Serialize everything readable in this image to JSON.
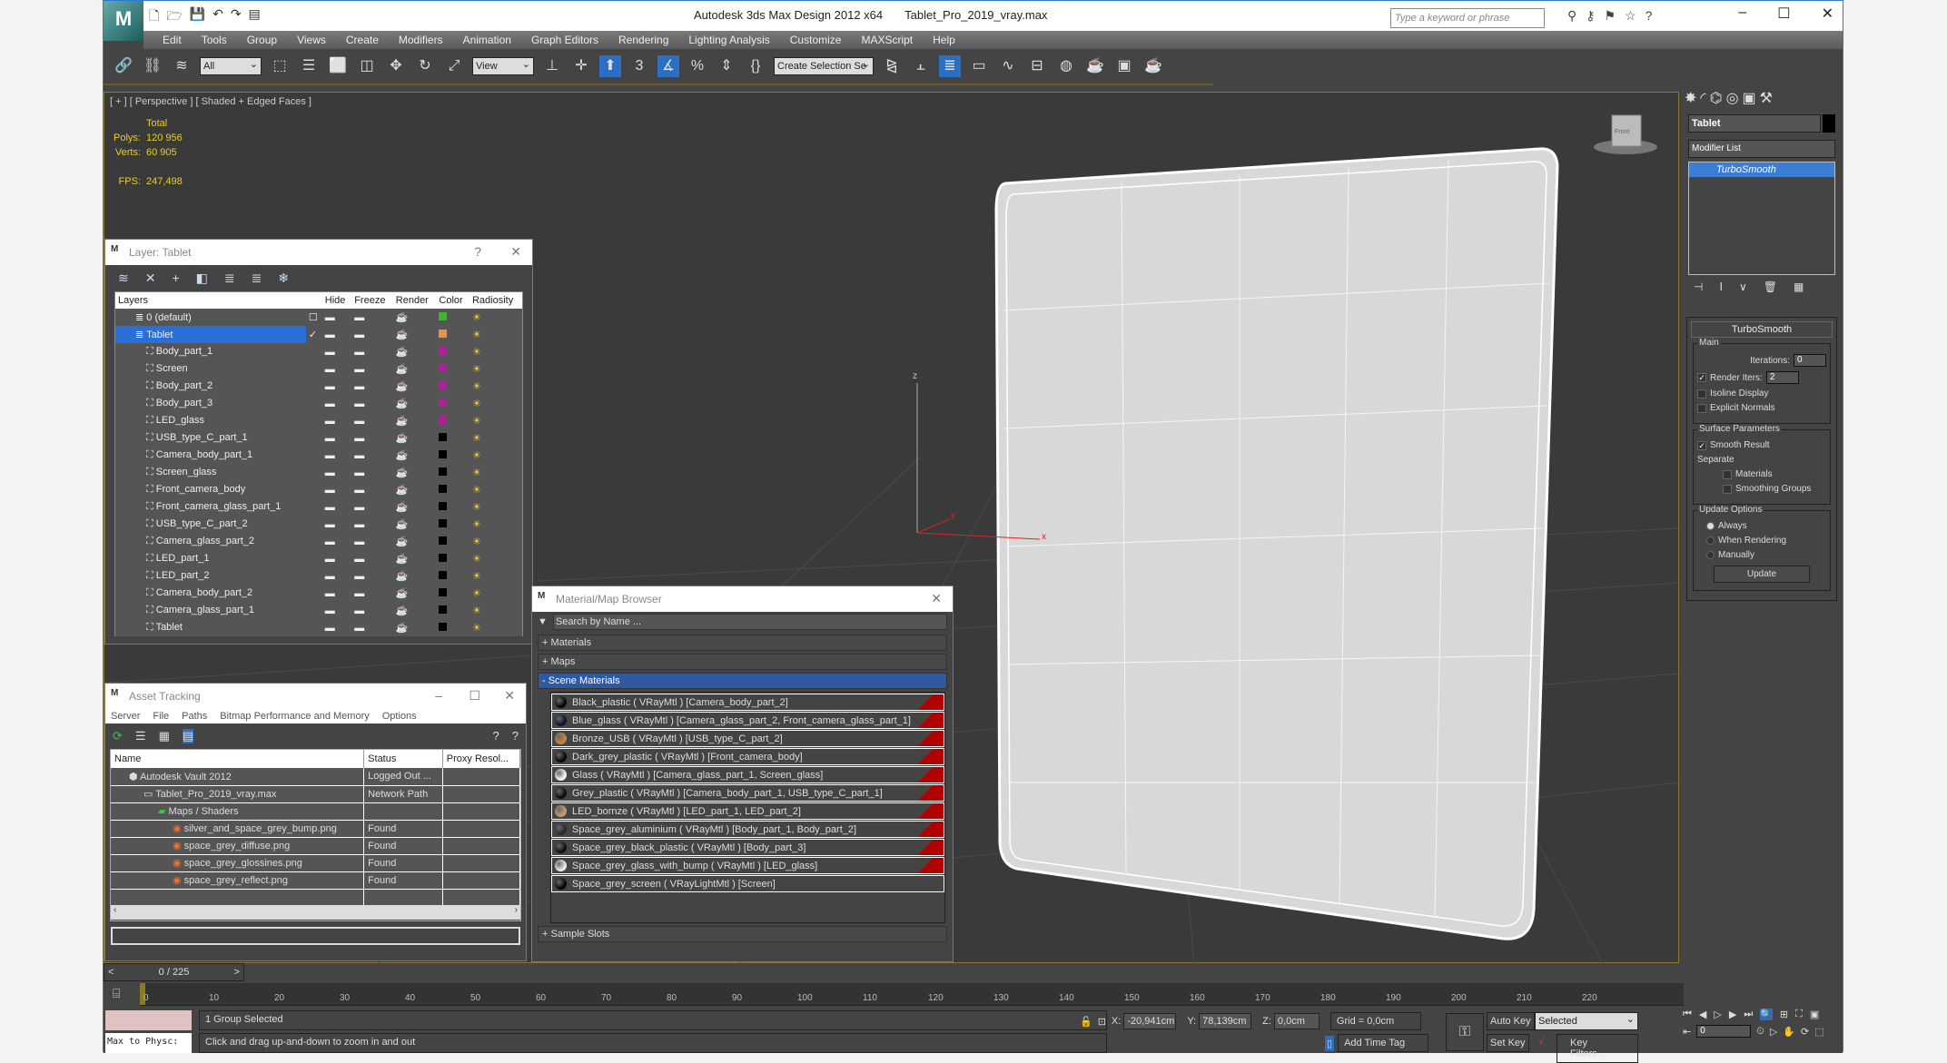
{
  "app": {
    "title": "Autodesk 3ds Max Design 2012 x64",
    "file": "Tablet_Pro_2019_vray.max",
    "logo": "3DS",
    "search_placeholder": "Type a keyword or phrase"
  },
  "menu": [
    "Edit",
    "Tools",
    "Group",
    "Views",
    "Create",
    "Modifiers",
    "Animation",
    "Graph Editors",
    "Rendering",
    "Lighting Analysis",
    "Customize",
    "MAXScript",
    "Help"
  ],
  "toolbar": {
    "selection_filter": "All",
    "ref_coord": "View",
    "selection_set": "Create Selection Se"
  },
  "viewport": {
    "label": "[ + ] [ Perspective ] [ Shaded + Edged Faces ]",
    "stats_header": "Total",
    "polys_label": "Polys:",
    "polys": "120 956",
    "verts_label": "Verts:",
    "verts": "60 905",
    "fps_label": "FPS:",
    "fps": "247,498",
    "axis_x": "x",
    "axis_y": "y",
    "axis_z": "z",
    "viewcube": "Front"
  },
  "command_panel": {
    "object_name": "Tablet",
    "object_color": "#000000",
    "modifier_list": "Modifier List",
    "stack": [
      "TurboSmooth"
    ],
    "rollout": "TurboSmooth",
    "main": "Main",
    "iterations_label": "Iterations:",
    "iterations": "0",
    "render_iters_label": "Render Iters:",
    "render_iters": "2",
    "render_iters_checked": true,
    "isoline": "Isoline Display",
    "explicit": "Explicit Normals",
    "surface": "Surface Parameters",
    "smooth_result": "Smooth Result",
    "separate": "Separate",
    "materials": "Materials",
    "smoothing_groups": "Smoothing Groups",
    "update_options": "Update Options",
    "always": "Always",
    "when_rendering": "When Rendering",
    "manually": "Manually",
    "update": "Update"
  },
  "layer_dialog": {
    "title": "Layer: Tablet",
    "help": "?",
    "columns": [
      "Layers",
      "",
      "Hide",
      "Freeze",
      "Render",
      "Color",
      "Radiosity"
    ],
    "layers": [
      {
        "name": "0 (default)",
        "color": "#3fb62a",
        "level": 0
      },
      {
        "name": "Tablet",
        "color": "#e8904a",
        "level": 0,
        "selected": true
      },
      {
        "name": "Body_part_1",
        "color": "#b0209a",
        "level": 1
      },
      {
        "name": "Screen",
        "color": "#b0209a",
        "level": 1
      },
      {
        "name": "Body_part_2",
        "color": "#b0209a",
        "level": 1
      },
      {
        "name": "Body_part_3",
        "color": "#b0209a",
        "level": 1
      },
      {
        "name": "LED_glass",
        "color": "#b0209a",
        "level": 1
      },
      {
        "name": "USB_type_C_part_1",
        "color": "#000000",
        "level": 1
      },
      {
        "name": "Camera_body_part_1",
        "color": "#000000",
        "level": 1
      },
      {
        "name": "Screen_glass",
        "color": "#000000",
        "level": 1
      },
      {
        "name": "Front_camera_body",
        "color": "#000000",
        "level": 1
      },
      {
        "name": "Front_camera_glass_part_1",
        "color": "#000000",
        "level": 1
      },
      {
        "name": "USB_type_C_part_2",
        "color": "#000000",
        "level": 1
      },
      {
        "name": "Camera_glass_part_2",
        "color": "#000000",
        "level": 1
      },
      {
        "name": "LED_part_1",
        "color": "#000000",
        "level": 1
      },
      {
        "name": "LED_part_2",
        "color": "#000000",
        "level": 1
      },
      {
        "name": "Camera_body_part_2",
        "color": "#000000",
        "level": 1
      },
      {
        "name": "Camera_glass_part_1",
        "color": "#000000",
        "level": 1
      },
      {
        "name": "Tablet",
        "color": "#000000",
        "level": 1
      }
    ]
  },
  "asset_tracking": {
    "title": "Asset Tracking",
    "menu": [
      "Server",
      "File",
      "Paths",
      "Bitmap Performance and Memory",
      "Options"
    ],
    "columns": [
      "Name",
      "Status",
      "Proxy Resol..."
    ],
    "rows": [
      {
        "name": "Autodesk Vault 2012",
        "status": "Logged Out ...",
        "indent": 0
      },
      {
        "name": "Tablet_Pro_2019_vray.max",
        "status": "Network Path",
        "indent": 1
      },
      {
        "name": "Maps / Shaders",
        "status": "",
        "indent": 2
      },
      {
        "name": "silver_and_space_grey_bump.png",
        "status": "Found",
        "indent": 3
      },
      {
        "name": "space_grey_diffuse.png",
        "status": "Found",
        "indent": 3
      },
      {
        "name": "space_grey_glossines.png",
        "status": "Found",
        "indent": 3
      },
      {
        "name": "space_grey_reflect.png",
        "status": "Found",
        "indent": 3
      }
    ]
  },
  "material_browser": {
    "title": "Material/Map Browser",
    "search_placeholder": "Search by Name ...",
    "materials_section": "+ Materials",
    "maps_section": "+ Maps",
    "scene_section": "-  Scene Materials",
    "sample_slots": "+ Sample Slots",
    "items": [
      {
        "label": "Black_plastic  ( VRayMtl )  [Camera_body_part_2]",
        "ball": "#050505",
        "flag": true
      },
      {
        "label": "Blue_glass  ( VRayMtl )  [Camera_glass_part_2, Front_camera_glass_part_1]",
        "ball": "#0d1430",
        "flag": true
      },
      {
        "label": "Bronze_USB  ( VRayMtl )  [USB_type_C_part_2]",
        "ball": "#c9803a",
        "flag": true
      },
      {
        "label": "Dark_grey_plastic  ( VRayMtl )  [Front_camera_body]",
        "ball": "#070707",
        "flag": true
      },
      {
        "label": "Glass  ( VRayMtl )  [Camera_glass_part_1, Screen_glass]",
        "ball": "#f4f4f4",
        "flag": true
      },
      {
        "label": "Grey_plastic  ( VRayMtl )  [Camera_body_part_1, USB_type_C_part_1]",
        "ball": "#0c0c0c",
        "flag": true
      },
      {
        "label": "LED_bornze  ( VRayMtl )  [LED_part_1, LED_part_2]",
        "ball": "#c9976a",
        "flag": true
      },
      {
        "label": "Space_grey_aluminium  ( VRayMtl )  [Body_part_1, Body_part_2]",
        "ball": "#2a2a2e",
        "flag": true
      },
      {
        "label": "Space_grey_black_plastic  ( VRayMtl )  [Body_part_3]",
        "ball": "#101010",
        "flag": true
      },
      {
        "label": "Space_grey_glass_with_bump  ( VRayMtl )  [LED_glass]",
        "ball": "#e8e8e8",
        "flag": true
      },
      {
        "label": "Space_grey_screen  ( VRayLightMtl )  [Screen]",
        "ball": "#050505",
        "flag": false
      }
    ]
  },
  "timeline": {
    "frame": "0 / 225",
    "prev": "<",
    "next": ">",
    "ticks": [
      "0",
      "10",
      "20",
      "30",
      "40",
      "50",
      "60",
      "70",
      "80",
      "90",
      "100",
      "110",
      "120",
      "130",
      "140",
      "150",
      "160",
      "170",
      "180",
      "190",
      "200",
      "210",
      "220"
    ]
  },
  "status": {
    "selection": "1 Group Selected",
    "prompt": "Click and drag up-and-down to zoom in and out",
    "maxscript": "Max to Physc:",
    "x_label": "X:",
    "x": "-20,941cm",
    "y_label": "Y:",
    "y": "78,139cm",
    "z_label": "Z:",
    "z": "0,0cm",
    "grid": "Grid = 0,0cm",
    "add_time_tag": "Add Time Tag",
    "auto_key": "Auto Key",
    "set_key": "Set Key",
    "key_mode": "Selected",
    "key_filters": "Key Filters...",
    "current_frame": "0"
  }
}
